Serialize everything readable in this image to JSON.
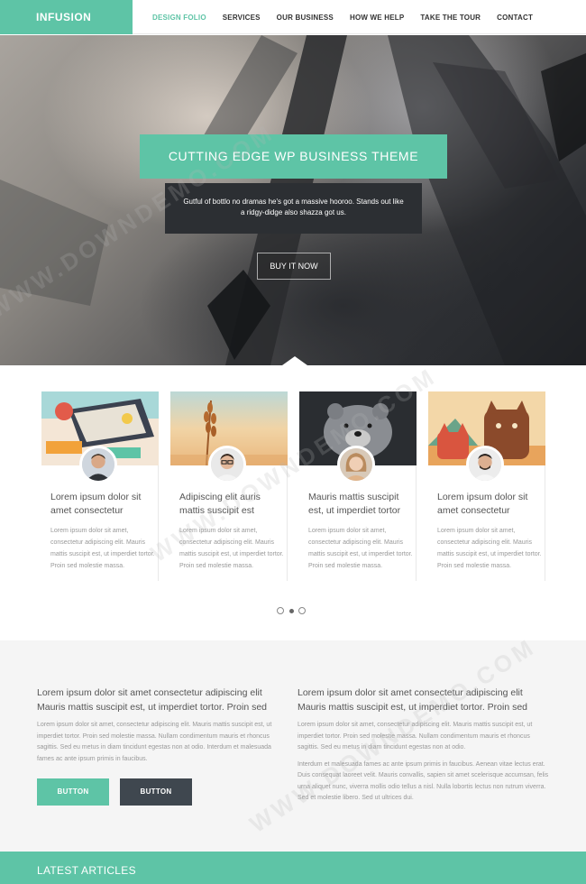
{
  "brand": {
    "logo": "INFUSION",
    "accent": "#5ec4a6",
    "dark": "#2c2f33"
  },
  "nav": {
    "items": [
      {
        "label": "DESIGN FOLIO",
        "active": true
      },
      {
        "label": "SERVICES",
        "active": false
      },
      {
        "label": "OUR BUSINESS",
        "active": false
      },
      {
        "label": "HOW WE HELP",
        "active": false
      },
      {
        "label": "TAKE THE TOUR",
        "active": false
      },
      {
        "label": "CONTACT",
        "active": false
      }
    ]
  },
  "hero": {
    "title": "CUTTING EDGE WP BUSINESS THEME",
    "description": "Gutful of bottlo no dramas he's got a massive hooroo. Stands out like a ridgy-didge also shazza got us.",
    "button": "BUY IT NOW"
  },
  "watermark": "WWW.DOWNDEMO.COM",
  "cards": [
    {
      "title": "Lorem ipsum dolor sit amet consectetur",
      "text": "Lorem ipsum dolor sit amet, consectetur adipiscing elit. Mauris mattis suscipit est, ut imperdiet tortor. Proin sed molestie massa."
    },
    {
      "title": "Adipiscing elit auris mattis suscipit est",
      "text": "Lorem ipsum dolor sit amet, consectetur adipiscing elit. Mauris mattis suscipit est, ut imperdiet tortor. Proin sed molestie massa."
    },
    {
      "title": "Mauris mattis suscipit est, ut imperdiet tortor",
      "text": "Lorem ipsum dolor sit amet, consectetur adipiscing elit. Mauris mattis suscipit est, ut imperdiet tortor. Proin sed molestie massa."
    },
    {
      "title": "Lorem ipsum dolor sit amet consectetur",
      "text": "Lorem ipsum dolor sit amet, consectetur adipiscing elit. Mauris mattis suscipit est, ut imperdiet tortor. Proin sed molestie massa."
    }
  ],
  "slider": {
    "dots": 3,
    "active_index": 1
  },
  "columns": {
    "left": {
      "heading": "Lorem ipsum dolor sit amet consectetur adipiscing elit Mauris mattis suscipit est, ut imperdiet tortor. Proin sed",
      "paragraph": "Lorem ipsum dolor sit amet, consectetur adipiscing elit. Mauris mattis suscipit est, ut imperdiet tortor. Proin sed molestie massa. Nullam condimentum mauris et rhoncus sagittis. Sed eu metus in diam tincidunt egestas non at odio. Interdum et malesuada fames ac ante ipsum primis in faucibus.",
      "button_primary": "BUTTON",
      "button_secondary": "BUTTON"
    },
    "right": {
      "heading": "Lorem ipsum dolor sit amet consectetur adipiscing elit Mauris mattis suscipit est, ut imperdiet tortor. Proin sed",
      "paragraph1": "Lorem ipsum dolor sit amet, consectetur adipiscing elit. Mauris mattis suscipit est, ut imperdiet tortor. Proin sed molestie massa. Nullam condimentum mauris et rhoncus sagittis. Sed eu metus in diam tincidunt egestas non at odio.",
      "paragraph2": "Interdum et malesuada fames ac ante ipsum primis in faucibus. Aenean vitae lectus erat. Duis consequat laoreet velit. Mauris convallis, sapien sit amet scelerisque accumsan, felis urna aliquet nunc, viverra mollis odio tellus a nisl. Nulla lobortis lectus non rutrum viverra. Sed et molestie libero. Sed ut ultrices dui."
    }
  },
  "latest": {
    "title": "LATEST ARTICLES"
  }
}
